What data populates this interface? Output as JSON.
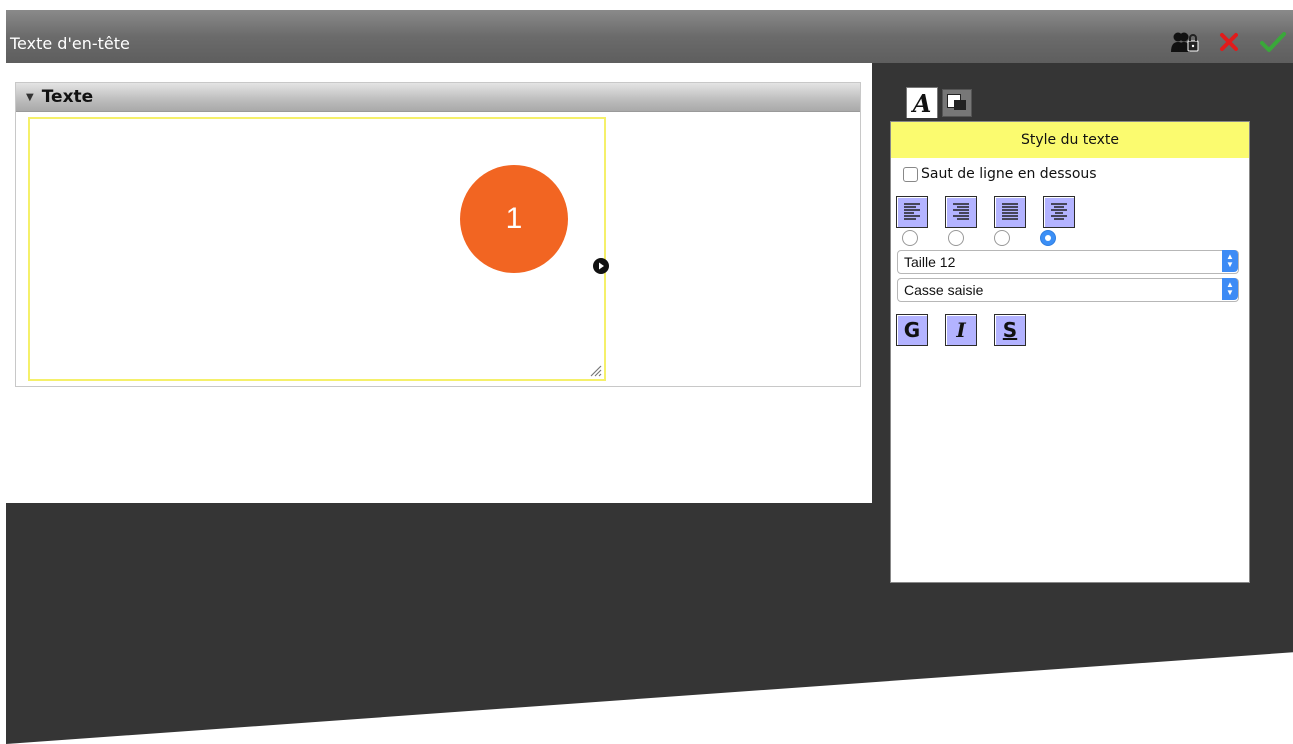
{
  "window": {
    "title": "Texte d'en-tête",
    "icons": [
      "users-lock-icon",
      "close-icon",
      "check-icon"
    ]
  },
  "section": {
    "title": "Texte",
    "textarea_value": ""
  },
  "badge": {
    "number": "1",
    "color": "#f26522"
  },
  "style_panel": {
    "tabs": [
      "text-style-tab",
      "background-style-tab"
    ],
    "header": "Style du texte",
    "line_break_label": "Saut de ligne en dessous",
    "line_break_checked": false,
    "alignments": [
      "left",
      "right",
      "justify",
      "center"
    ],
    "selected_alignment": "center",
    "size_select": "Taille 12",
    "case_select": "Casse saisie",
    "format_buttons": {
      "bold": "G",
      "italic": "I",
      "underline": "S"
    },
    "header_color": "#fbfb6f",
    "button_color": "#b3b3ff"
  }
}
